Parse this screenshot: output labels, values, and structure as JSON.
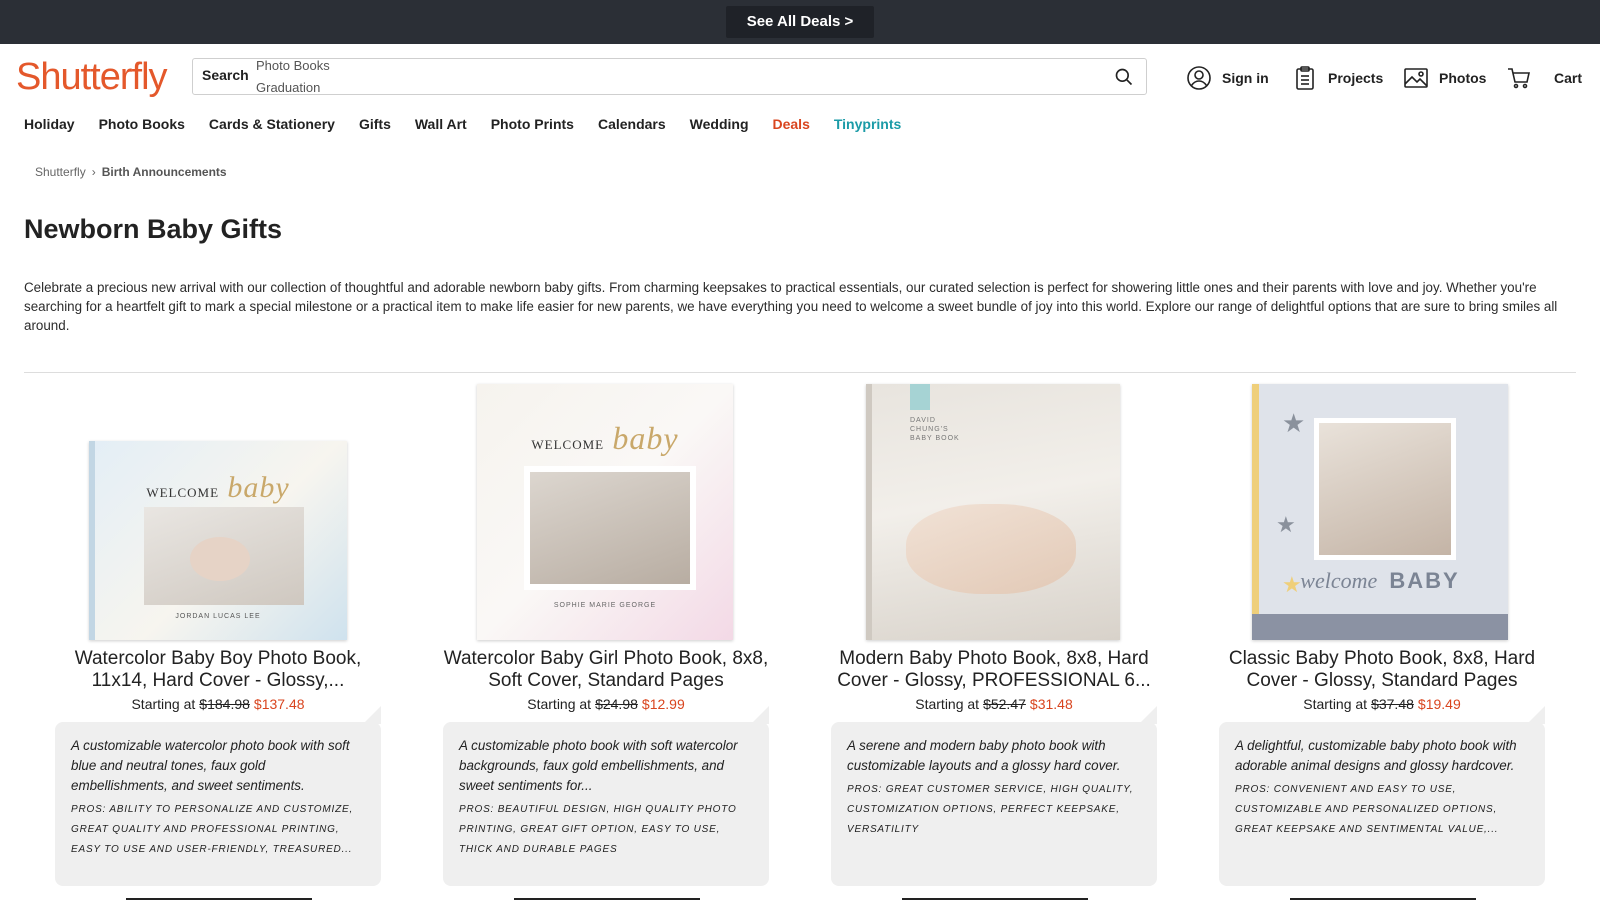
{
  "promo": {
    "label": "See All Deals >"
  },
  "header": {
    "logo": "Shutterfly",
    "search": {
      "label": "Search",
      "suggestions": [
        "Photo Books",
        "Graduation"
      ]
    },
    "links": {
      "sign_in": "Sign in",
      "projects": "Projects",
      "photos": "Photos",
      "cart": "Cart"
    }
  },
  "nav": {
    "items": [
      "Holiday",
      "Photo Books",
      "Cards & Stationery",
      "Gifts",
      "Wall Art",
      "Photo Prints",
      "Calendars",
      "Wedding",
      "Deals",
      "Tinyprints"
    ]
  },
  "breadcrumb": {
    "root": "Shutterfly",
    "current": "Birth Announcements"
  },
  "page": {
    "title": "Newborn Baby Gifts",
    "description": "Celebrate a precious new arrival with our collection of thoughtful and adorable newborn baby gifts. From charming keepsakes to practical essentials, our curated selection is perfect for showering little ones and their parents with love and joy. Whether you're searching for a heartfelt gift to mark a special milestone or a practical item to make life easier for new parents, we have everything you need to welcome a sweet bundle of joy into this world. Explore our range of delightful options that are sure to bring smiles all around."
  },
  "products": [
    {
      "title": "Watercolor Baby Boy Photo Book, 11x14, Hard Cover - Glossy,...",
      "price_prefix": "Starting at",
      "old_price": "$184.98",
      "new_price": "$137.48",
      "review": "A customizable watercolor photo book with soft blue and neutral tones, faux gold embellishments, and sweet sentiments.",
      "pros": "Pros: Ability to personalize and customize, great quality and professional printing, easy to use and user-friendly, treasured...",
      "cover": {
        "welcome": "WELCOME",
        "script": "baby",
        "name": "JORDAN LUCAS LEE",
        "tint": "#cfe2ee"
      }
    },
    {
      "title": "Watercolor Baby Girl Photo Book, 8x8, Soft Cover, Standard Pages",
      "price_prefix": "Starting at",
      "old_price": "$24.98",
      "new_price": "$12.99",
      "review": "A customizable photo book with soft watercolor backgrounds, faux gold embellishments, and sweet sentiments for...",
      "pros": "Pros: Beautiful design, high quality photo printing, great gift option, easy to use, thick and durable pages",
      "cover": {
        "welcome": "WELCOME",
        "script": "baby",
        "name": "SOPHIE MARIE GEORGE",
        "tint": "#f3d9e6"
      }
    },
    {
      "title": "Modern Baby Photo Book, 8x8, Hard Cover - Glossy, PROFESSIONAL 6...",
      "price_prefix": "Starting at",
      "old_price": "$52.47",
      "new_price": "$31.48",
      "review": "A serene and modern baby photo book with customizable layouts and a glossy hard cover.",
      "pros": "Pros: Great customer service, high quality, customization options, perfect keepsake, versatility",
      "cover": {
        "heading": "DAVID CHUNG'S BABY BOOK",
        "tint": "#e8e4de"
      }
    },
    {
      "title": "Classic Baby Photo Book, 8x8, Hard Cover - Glossy, Standard Pages",
      "price_prefix": "Starting at",
      "old_price": "$37.48",
      "new_price": "$19.49",
      "review": "A delightful, customizable baby photo book with adorable animal designs and glossy hardcover.",
      "pros": "Pros: Convenient and easy to use, customizable and personalized options, great keepsake and sentimental value,...",
      "cover": {
        "welcome": "welcome",
        "script": "BABY",
        "tint": "#dfe3ea"
      }
    }
  ],
  "colors": {
    "brand": "#e4582b",
    "deals": "#d9451f",
    "tinyprints": "#1b9ba7",
    "promo_bg": "#2b2f36"
  }
}
